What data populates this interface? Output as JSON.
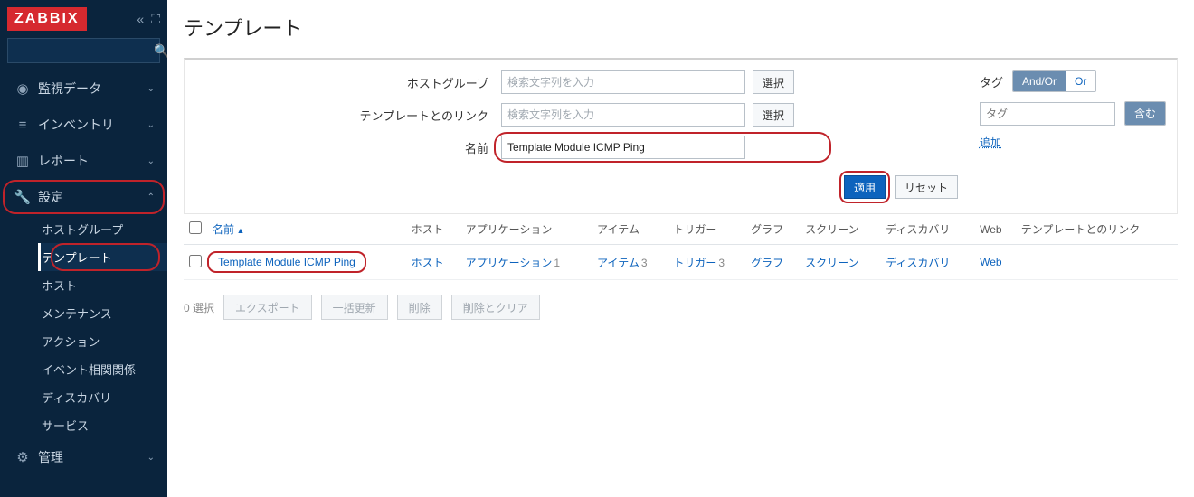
{
  "brand": "ZABBIX",
  "page_title": "テンプレート",
  "sidebar": {
    "items": [
      {
        "label": "監視データ",
        "icon": "eye"
      },
      {
        "label": "インベントリ",
        "icon": "list"
      },
      {
        "label": "レポート",
        "icon": "bars"
      },
      {
        "label": "設定",
        "icon": "wrench",
        "expanded": true,
        "highlight": true,
        "children": [
          {
            "label": "ホストグループ"
          },
          {
            "label": "テンプレート",
            "active": true,
            "highlight": true
          },
          {
            "label": "ホスト"
          },
          {
            "label": "メンテナンス"
          },
          {
            "label": "アクション"
          },
          {
            "label": "イベント相関関係"
          },
          {
            "label": "ディスカバリ"
          },
          {
            "label": "サービス"
          }
        ]
      },
      {
        "label": "管理",
        "icon": "gear"
      }
    ]
  },
  "filter": {
    "host_group_label": "ホストグループ",
    "host_group_placeholder": "検索文字列を入力",
    "linked_label": "テンプレートとのリンク",
    "linked_placeholder": "検索文字列を入力",
    "name_label": "名前",
    "name_value": "Template Module ICMP Ping",
    "select_btn": "選択",
    "apply_btn": "適用",
    "reset_btn": "リセット",
    "tag_label": "タグ",
    "tag_mode": {
      "andor": "And/Or",
      "or": "Or"
    },
    "tag_placeholder": "タグ",
    "contain_btn": "含む",
    "add_link": "追加"
  },
  "table": {
    "headers": {
      "name": "名前",
      "hosts": "ホスト",
      "apps": "アプリケーション",
      "items": "アイテム",
      "triggers": "トリガー",
      "graphs": "グラフ",
      "screens": "スクリーン",
      "discovery": "ディスカバリ",
      "web": "Web",
      "linked": "テンプレートとのリンク"
    },
    "rows": [
      {
        "name": "Template Module ICMP Ping",
        "hosts": "ホスト",
        "apps": "アプリケーション",
        "apps_cnt": "1",
        "items": "アイテム",
        "items_cnt": "3",
        "triggers": "トリガー",
        "triggers_cnt": "3",
        "graphs": "グラフ",
        "screens": "スクリーン",
        "discovery": "ディスカバリ",
        "web": "Web"
      }
    ]
  },
  "footer": {
    "selected": "0 選択",
    "export": "エクスポート",
    "massupdate": "一括更新",
    "delete": "削除",
    "deleteclear": "削除とクリア"
  }
}
